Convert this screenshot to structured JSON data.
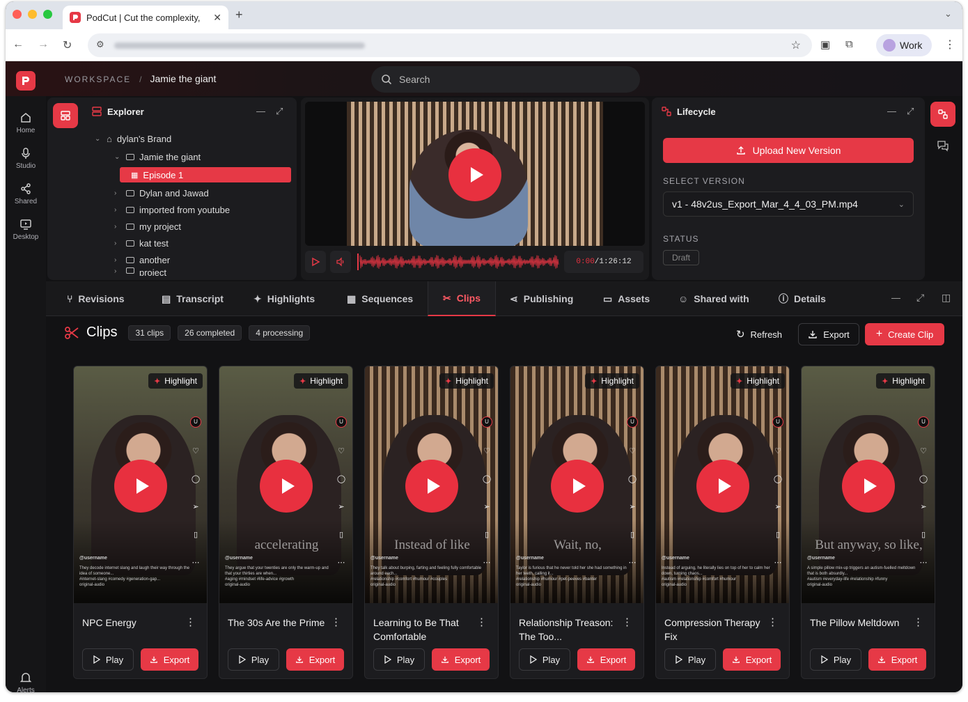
{
  "browser": {
    "tab_title": "PodCut | Cut the complexity,",
    "profile_label": "Work"
  },
  "app": {
    "breadcrumb_workspace": "WORKSPACE",
    "breadcrumb_sep": "/",
    "breadcrumb_current": "Jamie the giant",
    "search_placeholder": "Search",
    "accent": "#e63946"
  },
  "sidebar": {
    "items": [
      {
        "label": "Home",
        "icon": "home-icon"
      },
      {
        "label": "Studio",
        "icon": "mic-icon"
      },
      {
        "label": "Shared",
        "icon": "share-icon"
      },
      {
        "label": "Desktop",
        "icon": "desktop-icon"
      }
    ],
    "alerts_label": "Alerts"
  },
  "explorer": {
    "title": "Explorer",
    "tree": [
      {
        "label": "dylan's Brand"
      },
      {
        "label": "Jamie the giant"
      },
      {
        "label": "Episode 1"
      },
      {
        "label": "Dylan and Jawad"
      },
      {
        "label": "imported from youtube"
      },
      {
        "label": "my project"
      },
      {
        "label": "kat test"
      },
      {
        "label": "another"
      },
      {
        "label": "project"
      }
    ]
  },
  "player": {
    "time_current": "0:00",
    "time_total": "/1:26:12"
  },
  "lifecycle": {
    "title": "Lifecycle",
    "upload_label": "Upload New Version",
    "select_version_label": "SELECT VERSION",
    "version_value": "v1 - 48v2us_Export_Mar_4_4_03_PM.mp4",
    "status_label": "STATUS",
    "status_value": "Draft"
  },
  "tabs": [
    {
      "label": "Revisions"
    },
    {
      "label": "Transcript"
    },
    {
      "label": "Highlights"
    },
    {
      "label": "Sequences"
    },
    {
      "label": "Clips"
    },
    {
      "label": "Publishing"
    },
    {
      "label": "Assets"
    },
    {
      "label": "Shared with"
    },
    {
      "label": "Details"
    }
  ],
  "clips": {
    "title": "Clips",
    "count_chip": "31 clips",
    "completed_chip": "26 completed",
    "processing_chip": "4 processing",
    "refresh_label": "Refresh",
    "export_label": "Export",
    "create_label": "Create Clip",
    "badge_label": "Highlight",
    "play_label": "Play",
    "card_export_label": "Export",
    "cards": [
      {
        "title": "NPC Energy",
        "caption": "",
        "username": "@username",
        "desc": "They decode internet slang and laugh their way through the idea of someone...",
        "tags": "#internet-slang #comedy #generation-gap...",
        "audio": "original-audio"
      },
      {
        "title": "The 30s Are the Prime",
        "caption": "accelerating",
        "username": "@username",
        "desc": "They argue that your twenties are only the warm-up and that your thirties are when...",
        "tags": "#aging #mindset #life-advice #growth",
        "audio": "original-audio"
      },
      {
        "title": "Learning to Be That Comfortable",
        "caption": "Instead of like",
        "username": "@username",
        "desc": "They talk about burping, farting and feeling fully comfortable around each...",
        "tags": "#relationship #comfort #humour #couples",
        "audio": "original-audio"
      },
      {
        "title": "Relationship Treason: The Too...",
        "caption": "Wait, no,",
        "username": "@username",
        "desc": "Taylor is furious that he never told her she had something in her teeth, calling it...",
        "tags": "#relationship #humour #pet-peeves #banter",
        "audio": "original-audio"
      },
      {
        "title": "Compression Therapy Fix",
        "caption": "",
        "username": "@username",
        "desc": "Instead of arguing, he literally lies on top of her to calm her down, turning chaos...",
        "tags": "#autism #relationship #comfort #humour",
        "audio": "original-audio"
      },
      {
        "title": "The Pillow Meltdown",
        "caption": "But anyway, so like,",
        "username": "@username",
        "desc": "A simple pillow mix-up triggers an autism-fuelled meltdown that is both absurdly...",
        "tags": "#autism #everyday-life #relationship #funny",
        "audio": "original-audio"
      }
    ]
  }
}
